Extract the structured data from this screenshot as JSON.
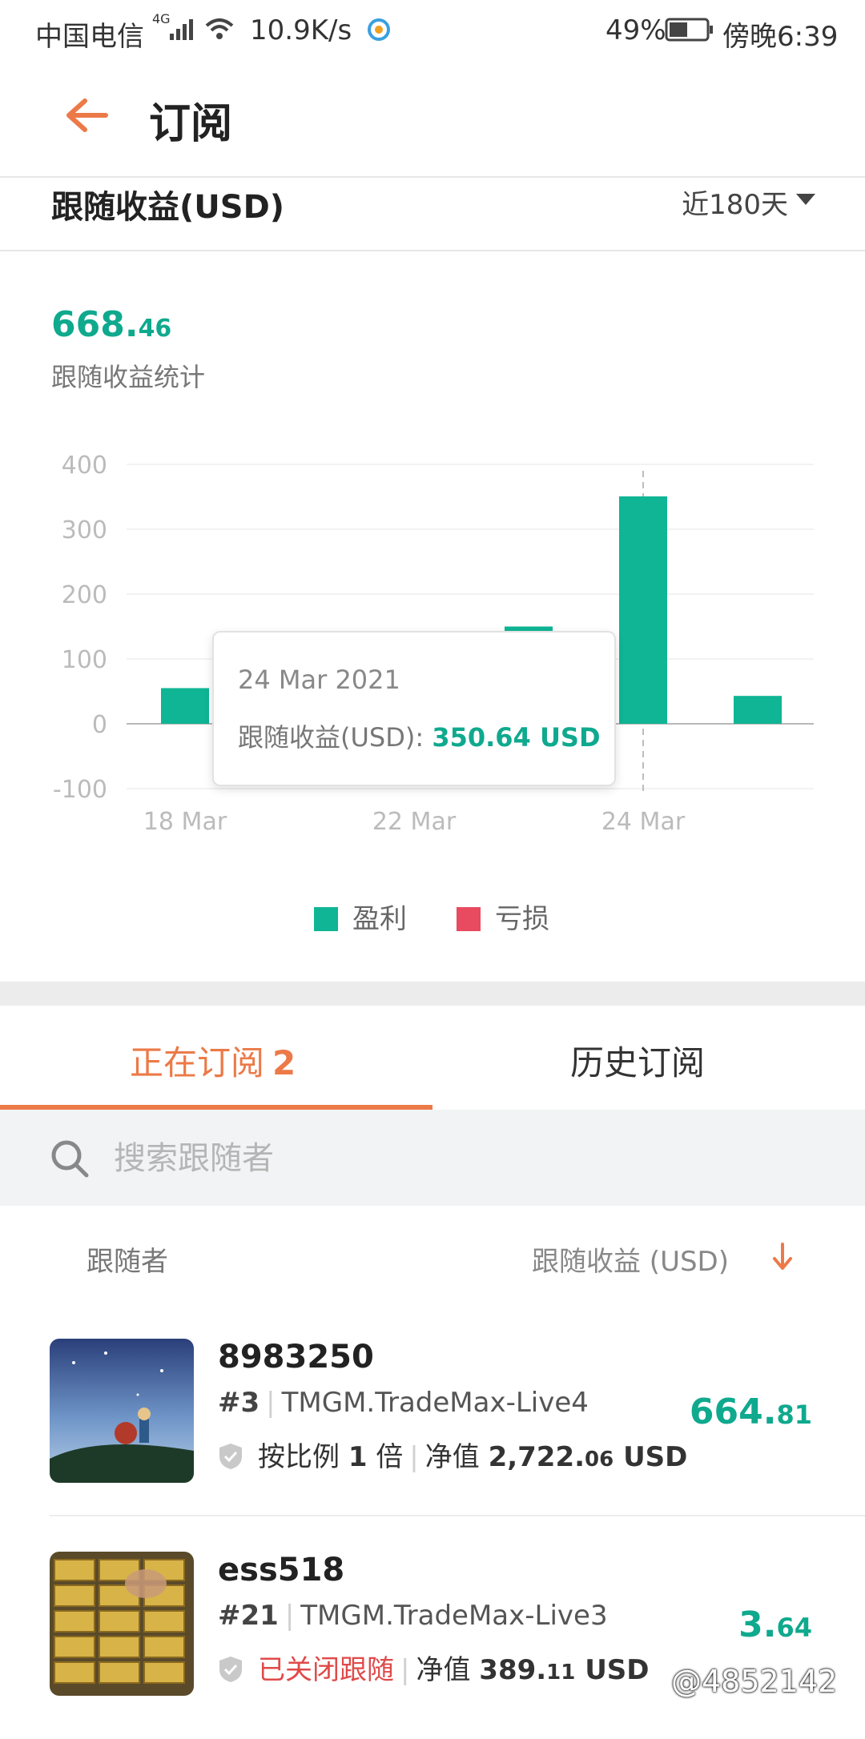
{
  "status_bar": {
    "carrier": "中国电信",
    "network": "4G",
    "speed": "10.9K/s",
    "battery": "49%",
    "time": "傍晚6:39"
  },
  "header": {
    "title": "订阅"
  },
  "section": {
    "title": "跟随收益(USD)",
    "period": "近180天"
  },
  "total": {
    "int": "668.",
    "dec": "46",
    "label": "跟随收益统计"
  },
  "chart_data": {
    "type": "bar",
    "ylim": [
      -100,
      400
    ],
    "yticks": [
      "400",
      "300",
      "200",
      "100",
      "0",
      "-100"
    ],
    "xticks": [
      "18 Mar",
      "22 Mar",
      "24 Mar"
    ],
    "bars": [
      {
        "date": "18 Mar 2021",
        "value": 55
      },
      {
        "date": "23 Mar 2021",
        "value": 150
      },
      {
        "date": "24 Mar 2021",
        "value": 350.64
      },
      {
        "date": "25 Mar 2021",
        "value": 43
      }
    ],
    "legend": [
      {
        "name": "盈利",
        "color": "#0fb594"
      },
      {
        "name": "亏损",
        "color": "#e84a5f"
      }
    ],
    "tooltip": {
      "date": "24 Mar 2021",
      "label": "跟随收益(USD): ",
      "value": "350.64 USD"
    }
  },
  "tabs": {
    "active": {
      "label": "正在订阅",
      "count": "2"
    },
    "history": {
      "label": "历史订阅"
    }
  },
  "search": {
    "placeholder": "搜索跟随者"
  },
  "list_header": {
    "follower": "跟随者",
    "profit": "跟随收益 (USD)"
  },
  "rows": [
    {
      "name": "8983250",
      "rank": "#3",
      "server": "TMGM.TradeMax-Live4",
      "mode_prefix": "按比例 ",
      "mode_value": "1",
      "mode_suffix": " 倍",
      "equity_label": "净值 ",
      "equity_int": "2,722.",
      "equity_dec": "06",
      "equity_unit": " USD",
      "profit_int": "664.",
      "profit_dec": "81"
    },
    {
      "name": "ess518",
      "rank": "#21",
      "server": "TMGM.TradeMax-Live3",
      "status": "已关闭跟随",
      "equity_label": "净值 ",
      "equity_int": "389.",
      "equity_dec": "11",
      "equity_unit": " USD",
      "profit_int": "3.",
      "profit_dec": "64"
    }
  ],
  "watermark": "@4852142"
}
